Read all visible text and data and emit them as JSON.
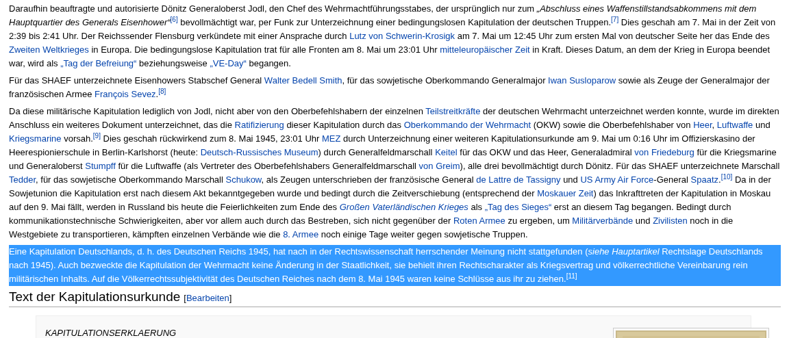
{
  "paragraphs": [
    {
      "selected": false,
      "segments": [
        {
          "kind": "text",
          "text": "Daraufhin beauftragte und autorisierte Dönitz Generaloberst Jodl, den Chef des Wehrmachtführungsstabes, der ursprünglich nur zum "
        },
        {
          "kind": "italic",
          "text": "„Abschluss eines Waffenstillstandsabkommens mit dem Hauptquartier des Generals Eisenhower“"
        },
        {
          "kind": "ref",
          "text": "[6]"
        },
        {
          "kind": "text",
          "text": " bevollmächtigt war, per Funk zur Unterzeichnung einer bedingungslosen Kapitulation der deutschen Truppen."
        },
        {
          "kind": "ref",
          "text": "[7]"
        },
        {
          "kind": "text",
          "text": " Dies geschah am 7. Mai in der Zeit von 2:39 bis 2:41 Uhr. Der Reichssender Flensburg verkündete mit einer Ansprache durch "
        },
        {
          "kind": "link",
          "text": "Lutz von Schwerin-Krosigk"
        },
        {
          "kind": "text",
          "text": " am 7. Mai um 12:45 Uhr zum ersten Mal von deutscher Seite her das Ende des "
        },
        {
          "kind": "link",
          "text": "Zweiten Weltkrieges"
        },
        {
          "kind": "text",
          "text": " in Europa. Die bedingungslose Kapitulation trat für alle Fronten am 8. Mai um 23:01 Uhr "
        },
        {
          "kind": "link",
          "text": "mitteleuropäischer Zeit"
        },
        {
          "kind": "text",
          "text": " in Kraft. Dieses Datum, an dem der Krieg in Europa beendet war, wird als "
        },
        {
          "kind": "link",
          "text": "„Tag der Befreiung“"
        },
        {
          "kind": "text",
          "text": " beziehungsweise "
        },
        {
          "kind": "link",
          "text": "„VE-Day“"
        },
        {
          "kind": "text",
          "text": " begangen."
        }
      ]
    },
    {
      "selected": false,
      "segments": [
        {
          "kind": "text",
          "text": "Für das SHAEF unterzeichnete Eisenhowers Stabschef General "
        },
        {
          "kind": "link",
          "text": "Walter Bedell Smith"
        },
        {
          "kind": "text",
          "text": ", für das sowjetische Oberkommando Generalmajor "
        },
        {
          "kind": "link",
          "text": "Iwan Susloparow"
        },
        {
          "kind": "text",
          "text": " sowie als Zeuge der Generalmajor der französischen Armee "
        },
        {
          "kind": "link",
          "text": "François Sevez"
        },
        {
          "kind": "text",
          "text": "."
        },
        {
          "kind": "ref",
          "text": "[8]"
        }
      ]
    },
    {
      "selected": false,
      "segments": [
        {
          "kind": "text",
          "text": "Da diese militärische Kapitulation lediglich von Jodl, nicht aber von den Oberbefehlshabern der einzelnen "
        },
        {
          "kind": "link",
          "text": "Teilstreitkräfte"
        },
        {
          "kind": "text",
          "text": " der deutschen Wehrmacht unterzeichnet werden konnte, wurde im direkten Anschluss ein weiteres Dokument unterzeichnet, das die "
        },
        {
          "kind": "link",
          "text": "Ratifizierung"
        },
        {
          "kind": "text",
          "text": " dieser Kapitulation durch das "
        },
        {
          "kind": "link",
          "text": "Oberkommando der Wehrmacht"
        },
        {
          "kind": "text",
          "text": " (OKW) sowie die Oberbefehlshaber von "
        },
        {
          "kind": "link",
          "text": "Heer"
        },
        {
          "kind": "text",
          "text": ", "
        },
        {
          "kind": "link",
          "text": "Luftwaffe"
        },
        {
          "kind": "text",
          "text": " und "
        },
        {
          "kind": "link",
          "text": "Kriegsmarine"
        },
        {
          "kind": "text",
          "text": " vorsah."
        },
        {
          "kind": "ref",
          "text": "[9]"
        },
        {
          "kind": "text",
          "text": " Dies geschah rückwirkend zum 8. Mai 1945, 23:01 Uhr "
        },
        {
          "kind": "link",
          "text": "MEZ"
        },
        {
          "kind": "text",
          "text": " durch Unterzeichnung einer weiteren Kapitulationsurkunde am 9. Mai um 0:16 Uhr im Offizierskasino der Heerespionierschule in Berlin-Karlshorst (heute: "
        },
        {
          "kind": "link",
          "text": "Deutsch-Russisches Museum"
        },
        {
          "kind": "text",
          "text": ") durch Generalfeldmarschall "
        },
        {
          "kind": "link",
          "text": "Keitel"
        },
        {
          "kind": "text",
          "text": " für das OKW und das Heer, Generaladmiral "
        },
        {
          "kind": "link",
          "text": "von Friedeburg"
        },
        {
          "kind": "text",
          "text": " für die Kriegsmarine und Generaloberst "
        },
        {
          "kind": "link",
          "text": "Stumpff"
        },
        {
          "kind": "text",
          "text": " für die Luftwaffe (als Vertreter des Oberbefehlshabers Generalfeldmarschall "
        },
        {
          "kind": "link",
          "text": "von Greim"
        },
        {
          "kind": "text",
          "text": "), alle drei bevollmächtigt durch Dönitz. Für das SHAEF unterzeichnete Marschall "
        },
        {
          "kind": "link",
          "text": "Tedder"
        },
        {
          "kind": "text",
          "text": ", für das sowjetische Oberkommando Marschall "
        },
        {
          "kind": "link",
          "text": "Schukow"
        },
        {
          "kind": "text",
          "text": ", als Zeugen unterschrieben der französische General "
        },
        {
          "kind": "link",
          "text": "de Lattre de Tassigny"
        },
        {
          "kind": "text",
          "text": " und "
        },
        {
          "kind": "link",
          "text": "US Army Air Force"
        },
        {
          "kind": "text",
          "text": "-General "
        },
        {
          "kind": "link",
          "text": "Spaatz"
        },
        {
          "kind": "text",
          "text": "."
        },
        {
          "kind": "ref",
          "text": "[10]"
        },
        {
          "kind": "text",
          "text": " Da in der Sowjetunion die Kapitulation erst nach diesem Akt bekanntgegeben wurde und bedingt durch die Zeitverschiebung (entsprechend der "
        },
        {
          "kind": "link",
          "text": "Moskauer Zeit"
        },
        {
          "kind": "text",
          "text": ") das Inkrafttreten der Kapitulation in Moskau auf den 9. Mai fällt, werden in Russland bis heute die Feierlichkeiten zum Ende des "
        },
        {
          "kind": "italic_link",
          "text": "Großen Vaterländischen Krieges"
        },
        {
          "kind": "text",
          "text": " als "
        },
        {
          "kind": "link",
          "text": "„Tag des Sieges“"
        },
        {
          "kind": "text",
          "text": " erst an diesem Tag begangen. Bedingt durch kommunikationstechnische Schwierigkeiten, aber vor allem auch durch das Bestreben, sich nicht gegenüber der "
        },
        {
          "kind": "link",
          "text": "Roten Armee"
        },
        {
          "kind": "text",
          "text": " zu ergeben, um "
        },
        {
          "kind": "link",
          "text": "Militärverbände"
        },
        {
          "kind": "text",
          "text": " und "
        },
        {
          "kind": "link",
          "text": "Zivilisten"
        },
        {
          "kind": "text",
          "text": " noch in die Westgebiete zu transportieren, kämpften einzelnen Verbände wie die "
        },
        {
          "kind": "link",
          "text": "8. Armee"
        },
        {
          "kind": "text",
          "text": " noch einige Tage weiter gegen sowjetische Truppen."
        }
      ]
    },
    {
      "selected": true,
      "segments": [
        {
          "kind": "text",
          "text": "Eine Kapitulation Deutschlands, d. h. des Deutschen Reichs 1945, hat nach in der Rechtswissenschaft herrschender Meinung nicht stattgefunden ("
        },
        {
          "kind": "italic",
          "text": "siehe Hauptartikel"
        },
        {
          "kind": "text",
          "text": " Rechtslage Deutschlands nach 1945). Auch bezweckte die Kapitulation der Wehrmacht keine Änderung in der Staatlichkeit, sie behielt ihren Rechtscharakter als Kriegsvertrag und völkerrechtliche Vereinbarung rein militärischen Inhalts. Auf die Völkerrechtssubjektivität des Deutschen Reiches nach dem 8. Mai 1945 waren keine Schlüsse aus ihr zu ziehen."
        },
        {
          "kind": "ref",
          "text": "[11]"
        }
      ]
    }
  ],
  "section": {
    "heading": "Text der Kapitulationsurkunde",
    "edit_bracket_open": "[",
    "edit_link": "Bearbeiten",
    "edit_bracket_close": "]"
  },
  "quote": {
    "text": "KAPITULATIONSERKLAERUNG"
  }
}
